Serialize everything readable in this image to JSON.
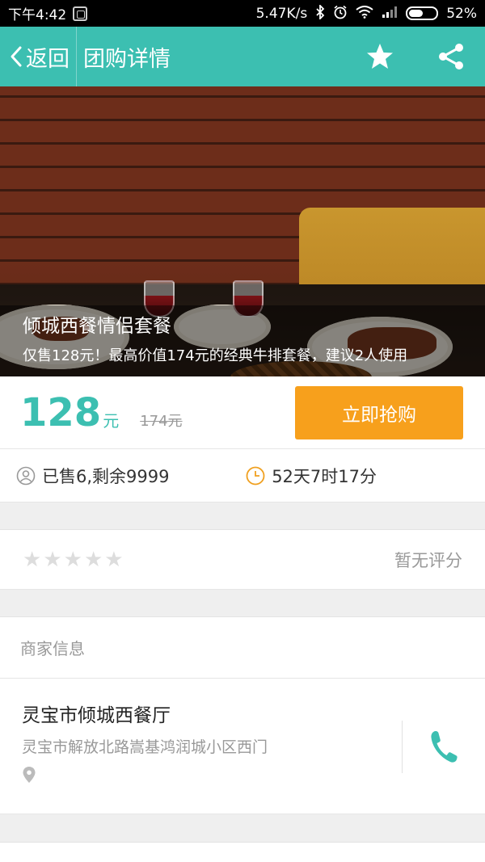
{
  "status_bar": {
    "time": "下午4:42",
    "speed": "5.47K/s",
    "battery": "52%",
    "battery_level": 0.52
  },
  "header": {
    "back_label": "返回",
    "title": "团购详情",
    "icons": [
      "back-chevron-icon",
      "star-icon",
      "share-icon"
    ]
  },
  "hero": {
    "title": "倾城西餐情侣套餐",
    "description": "仅售128元！最高价值174元的经典牛排套餐，建议2人使用"
  },
  "price": {
    "current": "128",
    "unit": "元",
    "original": "174元",
    "buy_label": "立即抢购"
  },
  "stats": {
    "sold": "已售6,剩余9999",
    "remaining_time": "52天7时17分"
  },
  "rating": {
    "stars_filled": 0,
    "stars_total": 5,
    "label": "暂无评分"
  },
  "merchant": {
    "section_title": "商家信息",
    "name": "灵宝市倾城西餐厅",
    "address": "灵宝市解放北路嵩基鸿润城小区西门"
  },
  "colors": {
    "primary": "#3cbfb1",
    "buy_button": "#f7a01c",
    "muted_text": "#999999"
  }
}
